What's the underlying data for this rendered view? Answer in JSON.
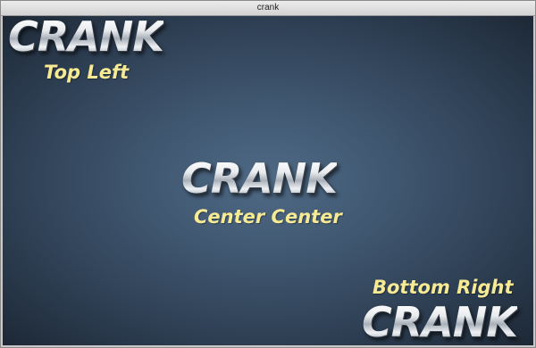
{
  "window": {
    "title": "crank"
  },
  "canvas": {
    "top_left": {
      "logo": "CRANK",
      "label": "Top Left"
    },
    "center_center": {
      "logo": "CRANK",
      "label": "Center Center"
    },
    "bottom_right": {
      "logo": "CRANK",
      "label": "Bottom Right"
    }
  },
  "colors": {
    "background_center": "#4f6a86",
    "background_edge": "#1d2835",
    "label_text": "#f7ea95",
    "logo_metal": "#dfe3e8"
  }
}
